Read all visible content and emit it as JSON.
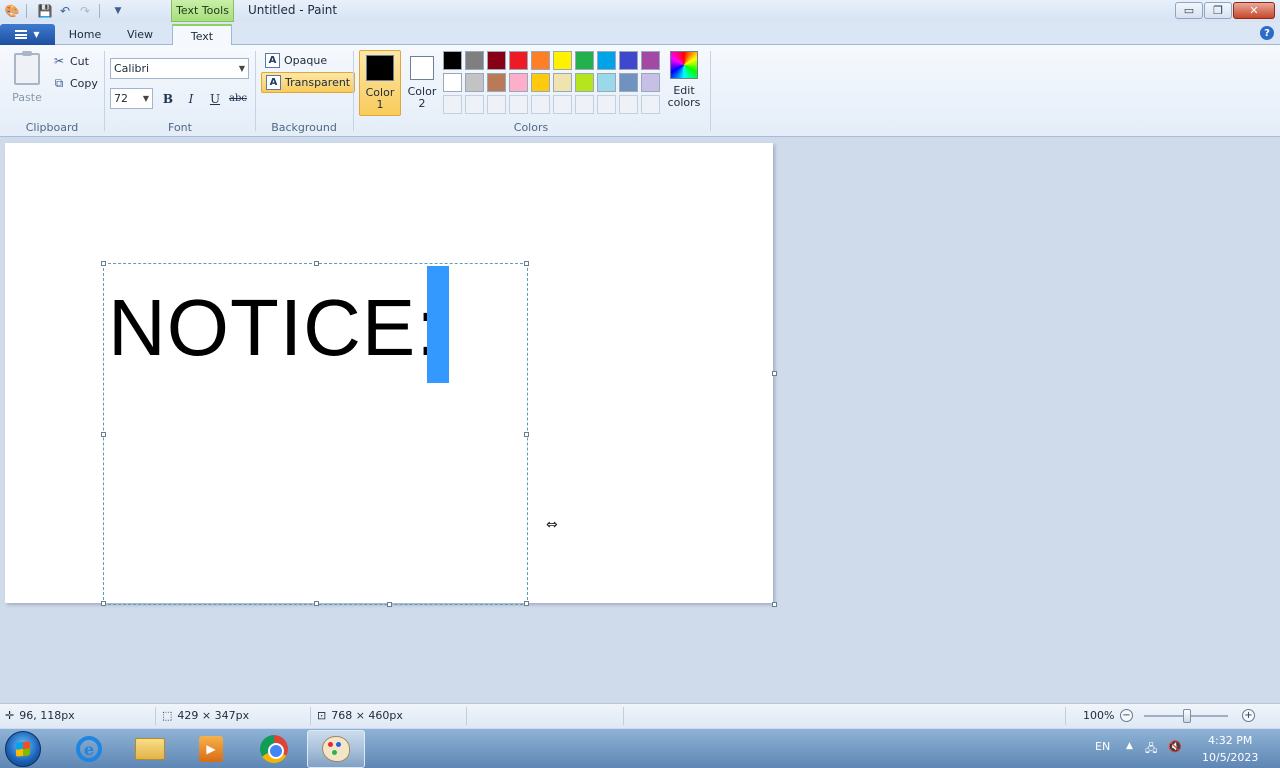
{
  "window": {
    "title": "Untitled - Paint",
    "context_tab": "Text Tools",
    "buttons": {
      "minimize": "▭",
      "restore": "❐",
      "close": "✕"
    }
  },
  "tabs": {
    "file_label": "",
    "home": "Home",
    "view": "View",
    "text": "Text",
    "active": "Text"
  },
  "clipboard": {
    "paste": "Paste",
    "cut": "Cut",
    "copy": "Copy",
    "group": "Clipboard"
  },
  "font": {
    "family": "Calibri",
    "size": "72",
    "bold": "B",
    "italic": "I",
    "underline": "U",
    "strikethrough": "abc",
    "group": "Font"
  },
  "background": {
    "opaque": "Opaque",
    "transparent": "Transparent",
    "selected": "Transparent",
    "group": "Background"
  },
  "colors": {
    "color1_label": "Color 1",
    "color2_label": "Color 2",
    "color1": "#000000",
    "color2": "#ffffff",
    "edit": "Edit colors",
    "group": "Colors",
    "palette_row1": [
      "#000000",
      "#7f7f7f",
      "#880015",
      "#ed1c24",
      "#ff7f27",
      "#fff200",
      "#22b14c",
      "#00a2e8",
      "#3f48cc",
      "#a349a4"
    ],
    "palette_row2": [
      "#ffffff",
      "#c3c3c3",
      "#b97a57",
      "#ffaec9",
      "#ffc90e",
      "#efe4b0",
      "#b5e61d",
      "#99d9ea",
      "#7092be",
      "#c8bfe7"
    ],
    "palette_row3_empty": 10
  },
  "canvas": {
    "text": "NOTICE:"
  },
  "status": {
    "cursor_pos": "96, 118px",
    "selection_size": "429 × 347px",
    "canvas_size": "768 × 460px",
    "zoom": "100%"
  },
  "taskbar": {
    "lang": "EN",
    "time": "4:32 PM",
    "date": "10/5/2023"
  }
}
